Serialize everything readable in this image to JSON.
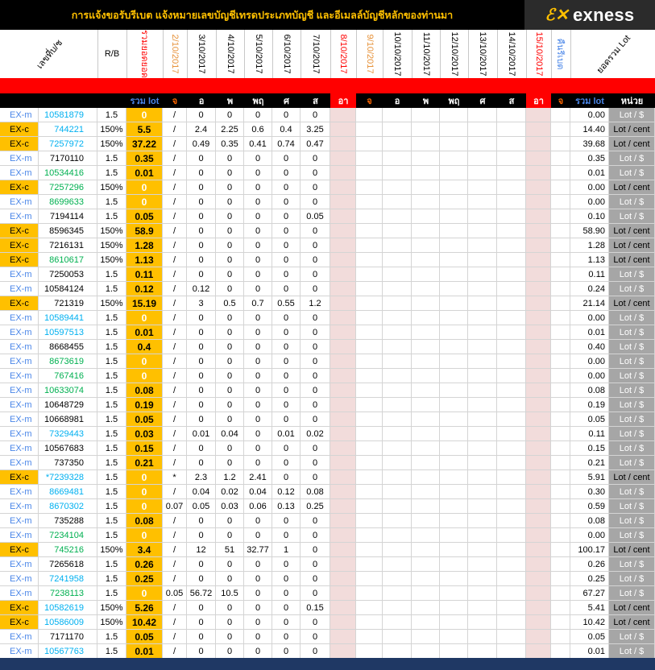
{
  "banner": {
    "title": "การแจ้งขอรับรีเบต  แจ้งหมายเลขบัญชีเทรดประเภทบัญชี และอีเมลล์บัญชีหลักของท่านมา",
    "logo_text": "exness",
    "logo_mark": "ℰ✕"
  },
  "header": {
    "account_label": "เลขที่บ/ช",
    "rb_label": "R/B",
    "total_label": "รวมยอดยอด",
    "dates": [
      "2/10/2017",
      "3/10/2017",
      "4/10/2017",
      "5/10/2017",
      "6/10/2017",
      "7/10/2017",
      "8/10/2017",
      "9/10/2017",
      "10/10/2017",
      "11/10/2017",
      "12/10/2017",
      "13/10/2017",
      "14/10/2017",
      "15/10/2017"
    ],
    "rebate_label": "คืนรีเบต",
    "lot_total_label": "ยอดรวม Lot"
  },
  "subheader": {
    "sum_lot": "รวม lot",
    "days": [
      "จ",
      "อ",
      "พ",
      "พฤ",
      "ศ",
      "ส",
      "อา"
    ],
    "days2": [
      "จ",
      "อ",
      "พ",
      "พฤ",
      "ศ",
      "ส",
      "อา"
    ],
    "rebate_col": "จ",
    "sum_lot2": "รวม lot",
    "unit": "หน่วย"
  },
  "rows": [
    {
      "type": "EX-m",
      "acct": "10581879",
      "rb": "1.5",
      "total": "0",
      "d": [
        "/",
        "0",
        "0",
        "0",
        "0",
        "0"
      ],
      "lot": "0.00",
      "unit": "Lot / $",
      "ac": "blue"
    },
    {
      "type": "EX-c",
      "acct": "744221",
      "rb": "150%",
      "total": "5.5",
      "d": [
        "/",
        "2.4",
        "2.25",
        "0.6",
        "0.4",
        "3.25"
      ],
      "lot": "14.40",
      "unit": "Lot / cent",
      "ac": "blue"
    },
    {
      "type": "EX-c",
      "acct": "7257972",
      "rb": "150%",
      "total": "37.22",
      "d": [
        "/",
        "0.49",
        "0.35",
        "0.41",
        "0.74",
        "0.47"
      ],
      "lot": "39.68",
      "unit": "Lot / cent",
      "ac": "blue"
    },
    {
      "type": "EX-m",
      "acct": "7170110",
      "rb": "1.5",
      "total": "0.35",
      "d": [
        "/",
        "0",
        "0",
        "0",
        "0",
        "0"
      ],
      "lot": "0.35",
      "unit": "Lot / $",
      "ac": "black"
    },
    {
      "type": "EX-m",
      "acct": "10534416",
      "rb": "1.5",
      "total": "0.01",
      "d": [
        "/",
        "0",
        "0",
        "0",
        "0",
        "0"
      ],
      "lot": "0.01",
      "unit": "Lot / $",
      "ac": "green"
    },
    {
      "type": "EX-c",
      "acct": "7257296",
      "rb": "150%",
      "total": "0",
      "d": [
        "/",
        "0",
        "0",
        "0",
        "0",
        "0"
      ],
      "lot": "0.00",
      "unit": "Lot / cent",
      "ac": "green"
    },
    {
      "type": "EX-m",
      "acct": "8699633",
      "rb": "1.5",
      "total": "0",
      "d": [
        "/",
        "0",
        "0",
        "0",
        "0",
        "0"
      ],
      "lot": "0.00",
      "unit": "Lot / $",
      "ac": "green"
    },
    {
      "type": "EX-m",
      "acct": "7194114",
      "rb": "1.5",
      "total": "0.05",
      "d": [
        "/",
        "0",
        "0",
        "0",
        "0",
        "0.05"
      ],
      "lot": "0.10",
      "unit": "Lot / $",
      "ac": "black"
    },
    {
      "type": "EX-c",
      "acct": "8596345",
      "rb": "150%",
      "total": "58.9",
      "d": [
        "/",
        "0",
        "0",
        "0",
        "0",
        "0"
      ],
      "lot": "58.90",
      "unit": "Lot / cent",
      "ac": "black"
    },
    {
      "type": "EX-c",
      "acct": "7216131",
      "rb": "150%",
      "total": "1.28",
      "d": [
        "/",
        "0",
        "0",
        "0",
        "0",
        "0"
      ],
      "lot": "1.28",
      "unit": "Lot / cent",
      "ac": "black"
    },
    {
      "type": "EX-c",
      "acct": "8610617",
      "rb": "150%",
      "total": "1.13",
      "d": [
        "/",
        "0",
        "0",
        "0",
        "0",
        "0"
      ],
      "lot": "1.13",
      "unit": "Lot / cent",
      "ac": "green"
    },
    {
      "type": "EX-m",
      "acct": "7250053",
      "rb": "1.5",
      "total": "0.11",
      "d": [
        "/",
        "0",
        "0",
        "0",
        "0",
        "0"
      ],
      "lot": "0.11",
      "unit": "Lot / $",
      "ac": "black"
    },
    {
      "type": "EX-m",
      "acct": "10584124",
      "rb": "1.5",
      "total": "0.12",
      "d": [
        "/",
        "0.12",
        "0",
        "0",
        "0",
        "0"
      ],
      "lot": "0.24",
      "unit": "Lot / $",
      "ac": "black"
    },
    {
      "type": "EX-c",
      "acct": "721319",
      "rb": "150%",
      "total": "15.19",
      "d": [
        "/",
        "3",
        "0.5",
        "0.7",
        "0.55",
        "1.2"
      ],
      "lot": "21.14",
      "unit": "Lot / cent",
      "ac": "black"
    },
    {
      "type": "EX-m",
      "acct": "10589441",
      "rb": "1.5",
      "total": "0",
      "d": [
        "/",
        "0",
        "0",
        "0",
        "0",
        "0"
      ],
      "lot": "0.00",
      "unit": "Lot / $",
      "ac": "blue"
    },
    {
      "type": "EX-m",
      "acct": "10597513",
      "rb": "1.5",
      "total": "0.01",
      "d": [
        "/",
        "0",
        "0",
        "0",
        "0",
        "0"
      ],
      "lot": "0.01",
      "unit": "Lot / $",
      "ac": "blue"
    },
    {
      "type": "EX-m",
      "acct": "8668455",
      "rb": "1.5",
      "total": "0.4",
      "d": [
        "/",
        "0",
        "0",
        "0",
        "0",
        "0"
      ],
      "lot": "0.40",
      "unit": "Lot / $",
      "ac": "black"
    },
    {
      "type": "EX-m",
      "acct": "8673619",
      "rb": "1.5",
      "total": "0",
      "d": [
        "/",
        "0",
        "0",
        "0",
        "0",
        "0"
      ],
      "lot": "0.00",
      "unit": "Lot / $",
      "ac": "green"
    },
    {
      "type": "EX-m",
      "acct": "767416",
      "rb": "1.5",
      "total": "0",
      "d": [
        "/",
        "0",
        "0",
        "0",
        "0",
        "0"
      ],
      "lot": "0.00",
      "unit": "Lot / $",
      "ac": "green"
    },
    {
      "type": "EX-m",
      "acct": "10633074",
      "rb": "1.5",
      "total": "0.08",
      "d": [
        "/",
        "0",
        "0",
        "0",
        "0",
        "0"
      ],
      "lot": "0.08",
      "unit": "Lot / $",
      "ac": "green"
    },
    {
      "type": "EX-m",
      "acct": "10648729",
      "rb": "1.5",
      "total": "0.19",
      "d": [
        "/",
        "0",
        "0",
        "0",
        "0",
        "0"
      ],
      "lot": "0.19",
      "unit": "Lot / $",
      "ac": "black"
    },
    {
      "type": "EX-m",
      "acct": "10668981",
      "rb": "1.5",
      "total": "0.05",
      "d": [
        "/",
        "0",
        "0",
        "0",
        "0",
        "0"
      ],
      "lot": "0.05",
      "unit": "Lot / $",
      "ac": "black"
    },
    {
      "type": "EX-m",
      "acct": "7329443",
      "rb": "1.5",
      "total": "0.03",
      "d": [
        "/",
        "0.01",
        "0.04",
        "0",
        "0.01",
        "0.02"
      ],
      "lot": "0.11",
      "unit": "Lot / $",
      "ac": "blue"
    },
    {
      "type": "EX-m",
      "acct": "10567683",
      "rb": "1.5",
      "total": "0.15",
      "d": [
        "/",
        "0",
        "0",
        "0",
        "0",
        "0"
      ],
      "lot": "0.15",
      "unit": "Lot / $",
      "ac": "black"
    },
    {
      "type": "EX-m",
      "acct": "737350",
      "rb": "1.5",
      "total": "0.21",
      "d": [
        "/",
        "0",
        "0",
        "0",
        "0",
        "0"
      ],
      "lot": "0.21",
      "unit": "Lot / $",
      "ac": "black"
    },
    {
      "type": "EX-c",
      "acct": "*7239328",
      "rb": "1.5",
      "total": "0",
      "d": [
        "*",
        "2.3",
        "1.2",
        "2.41",
        "0",
        "0"
      ],
      "lot": "5.91",
      "unit": "Lot / cent",
      "ac": "blue"
    },
    {
      "type": "EX-m",
      "acct": "8669481",
      "rb": "1.5",
      "total": "0",
      "d": [
        "/",
        "0.04",
        "0.02",
        "0.04",
        "0.12",
        "0.08"
      ],
      "lot": "0.30",
      "unit": "Lot / $",
      "ac": "blue"
    },
    {
      "type": "EX-m",
      "acct": "8670302",
      "rb": "1.5",
      "total": "0",
      "d": [
        "0.07",
        "0.05",
        "0.03",
        "0.06",
        "0.13",
        "0.25"
      ],
      "lot": "0.59",
      "unit": "Lot / $",
      "ac": "blue"
    },
    {
      "type": "EX-m",
      "acct": "735288",
      "rb": "1.5",
      "total": "0.08",
      "d": [
        "/",
        "0",
        "0",
        "0",
        "0",
        "0"
      ],
      "lot": "0.08",
      "unit": "Lot / $",
      "ac": "black"
    },
    {
      "type": "EX-m",
      "acct": "7234104",
      "rb": "1.5",
      "total": "0",
      "d": [
        "/",
        "0",
        "0",
        "0",
        "0",
        "0"
      ],
      "lot": "0.00",
      "unit": "Lot / $",
      "ac": "green"
    },
    {
      "type": "EX-c",
      "acct": "745216",
      "rb": "150%",
      "total": "3.4",
      "d": [
        "/",
        "12",
        "51",
        "32.77",
        "1",
        "0"
      ],
      "lot": "100.17",
      "unit": "Lot / cent",
      "ac": "green"
    },
    {
      "type": "EX-m",
      "acct": "7265618",
      "rb": "1.5",
      "total": "0.26",
      "d": [
        "/",
        "0",
        "0",
        "0",
        "0",
        "0"
      ],
      "lot": "0.26",
      "unit": "Lot / $",
      "ac": "black"
    },
    {
      "type": "EX-m",
      "acct": "7241958",
      "rb": "1.5",
      "total": "0.25",
      "d": [
        "/",
        "0",
        "0",
        "0",
        "0",
        "0"
      ],
      "lot": "0.25",
      "unit": "Lot / $",
      "ac": "blue"
    },
    {
      "type": "EX-m",
      "acct": "7238113",
      "rb": "1.5",
      "total": "0",
      "d": [
        "0.05",
        "56.72",
        "10.5",
        "0",
        "0",
        "0"
      ],
      "lot": "67.27",
      "unit": "Lot / $",
      "ac": "green"
    },
    {
      "type": "EX-c",
      "acct": "10582619",
      "rb": "150%",
      "total": "5.26",
      "d": [
        "/",
        "0",
        "0",
        "0",
        "0",
        "0.15"
      ],
      "lot": "5.41",
      "unit": "Lot / cent",
      "ac": "blue"
    },
    {
      "type": "EX-c",
      "acct": "10586009",
      "rb": "150%",
      "total": "10.42",
      "d": [
        "/",
        "0",
        "0",
        "0",
        "0",
        "0"
      ],
      "lot": "10.42",
      "unit": "Lot / cent",
      "ac": "blue"
    },
    {
      "type": "EX-m",
      "acct": "7171170",
      "rb": "1.5",
      "total": "0.05",
      "d": [
        "/",
        "0",
        "0",
        "0",
        "0",
        "0"
      ],
      "lot": "0.05",
      "unit": "Lot / $",
      "ac": "black"
    },
    {
      "type": "EX-m",
      "acct": "10567763",
      "rb": "1.5",
      "total": "0.01",
      "d": [
        "/",
        "0",
        "0",
        "0",
        "0",
        "0"
      ],
      "lot": "0.01",
      "unit": "Lot / $",
      "ac": "blue"
    }
  ],
  "colors": {
    "banner_bg": "#000000",
    "banner_text": "#ffc000",
    "red_bar": "#ff0000",
    "total_col": "#ffc000",
    "exc_bg": "#ffc000",
    "exm_text": "#4a86e8",
    "sunday_bg": "#f2dcdb",
    "unit_bg": "#a6a6a6",
    "footer": "#1f3864",
    "acct_blue": "#00b0f0",
    "acct_green": "#00b050"
  }
}
